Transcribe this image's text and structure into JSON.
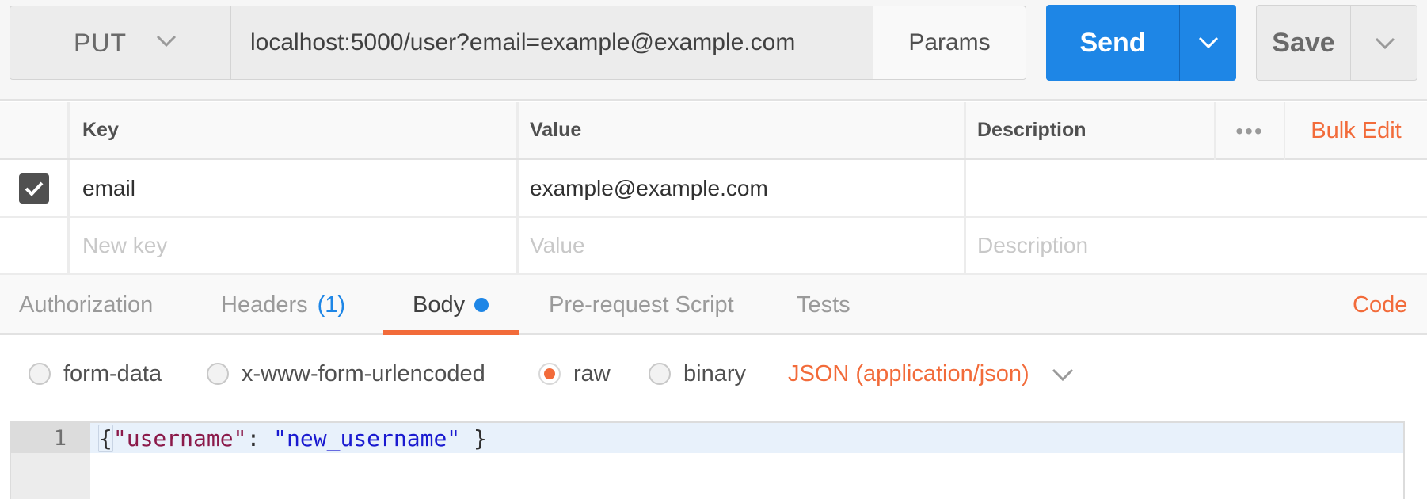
{
  "request": {
    "method": "PUT",
    "url": "localhost:5000/user?email=example@example.com",
    "params_label": "Params",
    "send_label": "Send",
    "save_label": "Save"
  },
  "params_table": {
    "headers": {
      "key": "Key",
      "value": "Value",
      "description": "Description"
    },
    "more_label": "•••",
    "bulk_edit_label": "Bulk Edit",
    "rows": [
      {
        "checked": true,
        "key": "email",
        "value": "example@example.com",
        "description": ""
      }
    ],
    "placeholders": {
      "key": "New key",
      "value": "Value",
      "description": "Description"
    }
  },
  "tabs": {
    "items": [
      {
        "label": "Authorization"
      },
      {
        "label": "Headers",
        "count": "(1)"
      },
      {
        "label": "Body",
        "active": true,
        "modified": true
      },
      {
        "label": "Pre-request Script"
      },
      {
        "label": "Tests"
      }
    ],
    "code_label": "Code"
  },
  "body_types": {
    "options": [
      {
        "label": "form-data",
        "selected": false
      },
      {
        "label": "x-www-form-urlencoded",
        "selected": false
      },
      {
        "label": "raw",
        "selected": true
      },
      {
        "label": "binary",
        "selected": false
      }
    ],
    "content_type": "JSON (application/json)"
  },
  "editor": {
    "line_number": "1",
    "open_brace": "{",
    "key": "\"username\"",
    "colon": ": ",
    "value": "\"new_username\"",
    "close_brace": " }"
  },
  "colors": {
    "accent": "#f26b3a",
    "send": "#1e86e6",
    "checkbox": "#505050"
  }
}
